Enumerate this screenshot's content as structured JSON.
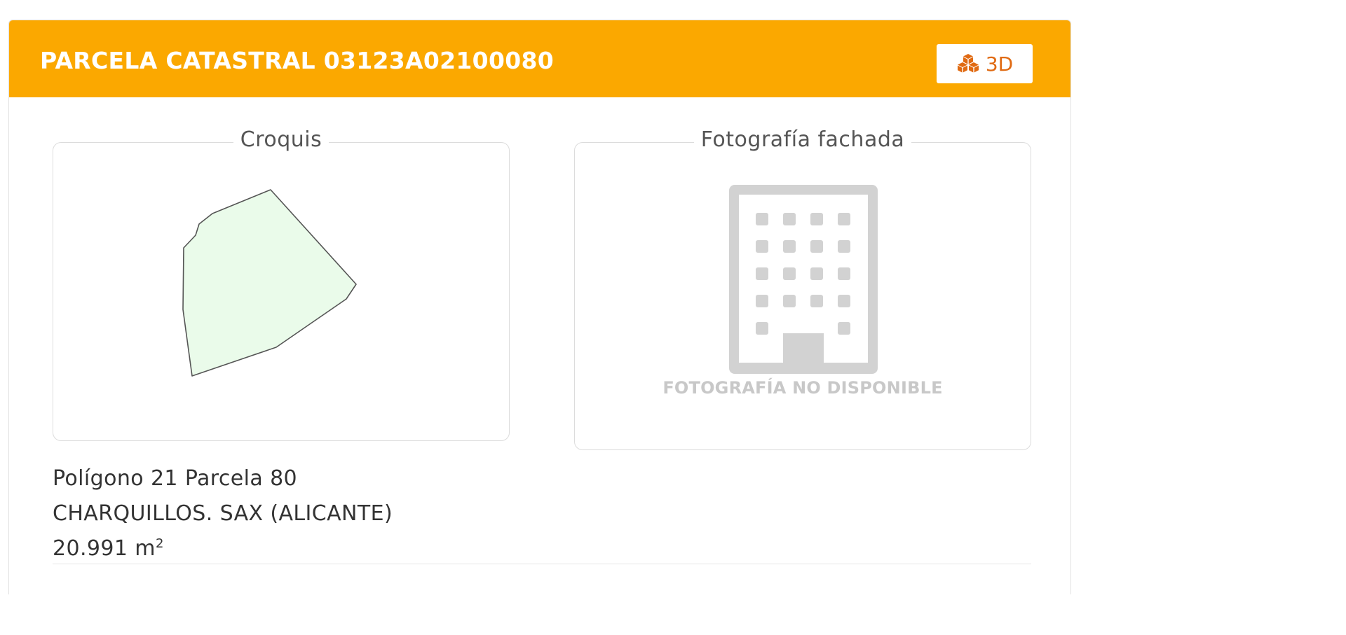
{
  "header": {
    "title": "PARCELA CATASTRAL 03123A02100080",
    "button_3d_label": "3D",
    "button_3d_icon": "cubes-icon",
    "accent_color": "#fba800"
  },
  "croquis": {
    "legend": "Croquis",
    "fill_color": "#eafbea",
    "stroke_color": "#555555"
  },
  "fachada": {
    "legend": "Fotografía fachada",
    "placeholder_icon": "building-icon",
    "placeholder_text": "FOTOGRAFÍA NO DISPONIBLE"
  },
  "parcel": {
    "location_line": "Polígono 21 Parcela 80",
    "place_line": "CHARQUILLOS. SAX (ALICANTE)",
    "area_value": "20.991 m",
    "area_unit_superscript": "2"
  }
}
